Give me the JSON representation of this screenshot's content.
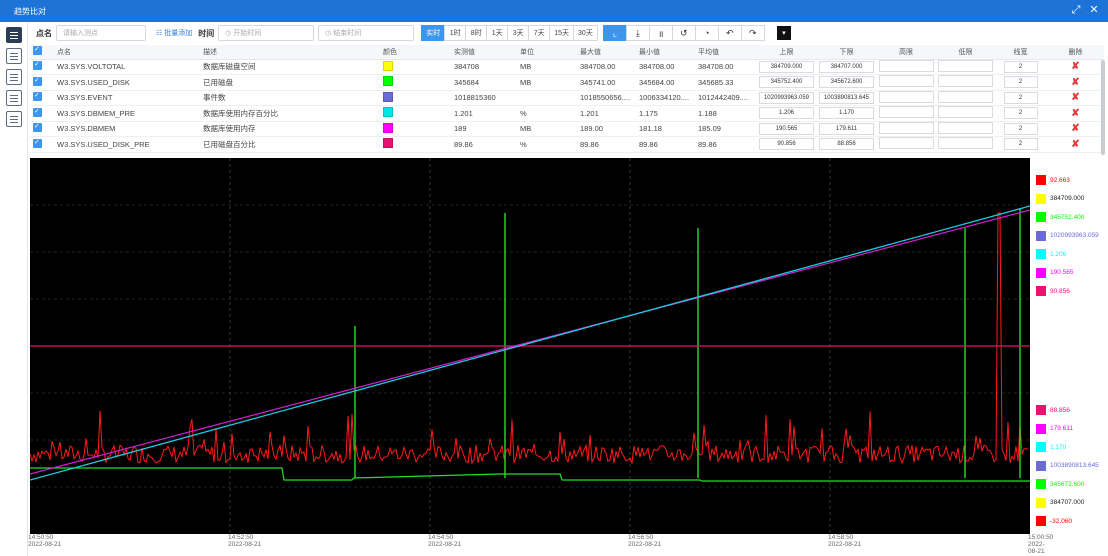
{
  "window": {
    "title": "趋势比对"
  },
  "toolbar": {
    "point_label": "点名",
    "point_placeholder": "请输入测点",
    "batch_add": "批量添加",
    "time_label": "时间",
    "start_placeholder": "开始时间",
    "end_placeholder": "结束时间",
    "ranges": [
      "实时",
      "1时",
      "8时",
      "1天",
      "3天",
      "7天",
      "15天",
      "30天"
    ],
    "active_range": "实时"
  },
  "table": {
    "columns": [
      "点名",
      "描述",
      "颜色",
      "实测值",
      "单位",
      "最大值",
      "最小值",
      "平均值",
      "上限",
      "下限",
      "高限",
      "低限",
      "线宽",
      "删除"
    ],
    "rows": [
      {
        "name": "W3.SYS.VOLTOTAL",
        "desc": "数据库磁盘空间",
        "color": "#ffff00",
        "value": "384708",
        "unit": "MB",
        "max": "384708.00",
        "min": "384708.00",
        "avg": "384708.00",
        "upper": "384709.000",
        "lower": "384707.000",
        "high": "",
        "low": "",
        "width": "2"
      },
      {
        "name": "W3.SYS.USED_DISK",
        "desc": "已用磁盘",
        "color": "#00ff00",
        "value": "345684",
        "unit": "MB",
        "max": "345741.00",
        "min": "345684.00",
        "avg": "345685.33",
        "upper": "345752.400",
        "lower": "345672.600",
        "high": "",
        "low": "",
        "width": "2"
      },
      {
        "name": "W3.SYS.EVENT",
        "desc": "事件数",
        "color": "#6b6bd6",
        "value": "1018815360",
        "unit": "",
        "max": "1018550656....",
        "min": "1006334120....",
        "avg": "1012442409....",
        "upper": "1020993963.059",
        "lower": "1003890813.645",
        "high": "",
        "low": "",
        "width": "2"
      },
      {
        "name": "W3.SYS.DBMEM_PRE",
        "desc": "数据库使用内存百分比",
        "color": "#00e5e5",
        "value": "1.201",
        "unit": "%",
        "max": "1.201",
        "min": "1.175",
        "avg": "1.188",
        "upper": "1.206",
        "lower": "1.170",
        "high": "",
        "low": "",
        "width": "2"
      },
      {
        "name": "W3.SYS.DBMEM",
        "desc": "数据库使用内存",
        "color": "#ff00ff",
        "value": "189",
        "unit": "MB",
        "max": "189.00",
        "min": "181.18",
        "avg": "185.09",
        "upper": "190.565",
        "lower": "179.611",
        "high": "",
        "low": "",
        "width": "2"
      },
      {
        "name": "W3.SYS.USED_DISK_PRE",
        "desc": "已用磁盘百分比",
        "color": "#ee1070",
        "value": "89.86",
        "unit": "%",
        "max": "89.86",
        "min": "89.86",
        "avg": "89.86",
        "upper": "90.856",
        "lower": "88.856",
        "high": "",
        "low": "",
        "width": "2"
      }
    ]
  },
  "legend_upper": [
    {
      "color": "#ff0000",
      "value": "92.663"
    },
    {
      "color": "#ffff00",
      "value": "384709.000"
    },
    {
      "color": "#00ff00",
      "value": "345752.400"
    },
    {
      "color": "#6b6bd6",
      "value": "1020993963.059"
    },
    {
      "color": "#00ffff",
      "value": "1.206"
    },
    {
      "color": "#ff00ff",
      "value": "190.565"
    },
    {
      "color": "#ee1070",
      "value": "90.856"
    }
  ],
  "legend_lower": [
    {
      "color": "#ee1070",
      "value": "88.856"
    },
    {
      "color": "#ff00ff",
      "value": "179.611"
    },
    {
      "color": "#00ffff",
      "value": "1.170"
    },
    {
      "color": "#6b6bd6",
      "value": "1003890813.645"
    },
    {
      "color": "#00ff00",
      "value": "345672.600"
    },
    {
      "color": "#ffff00",
      "value": "384707.000"
    },
    {
      "color": "#ff0000",
      "value": "-32.060"
    }
  ],
  "chart_data": {
    "type": "line",
    "x": [
      "14:50:50",
      "14:52:50",
      "14:54:50",
      "14:56:50",
      "14:58:50",
      "15:00:50"
    ],
    "x_date": "2022-08-21",
    "grid": true,
    "series": [
      {
        "name": "W3.SYS.DBMEM_PRE",
        "color": "#00ffff",
        "trend": "linear rising 1.175 → 1.201"
      },
      {
        "name": "W3.SYS.DBMEM",
        "color": "#ff00ff",
        "trend": "linear rising 181.18 → 189.00"
      },
      {
        "name": "W3.SYS.USED_DISK_PRE",
        "color": "#ee1070",
        "trend": "constant 89.86"
      },
      {
        "name": "W3.SYS.USED_DISK",
        "color": "#00ff00",
        "trend": "step around 345684 with spikes to 345741"
      },
      {
        "name": "W3.SYS.EVENT",
        "color": "#ff0000",
        "trend": "noisy"
      }
    ]
  }
}
